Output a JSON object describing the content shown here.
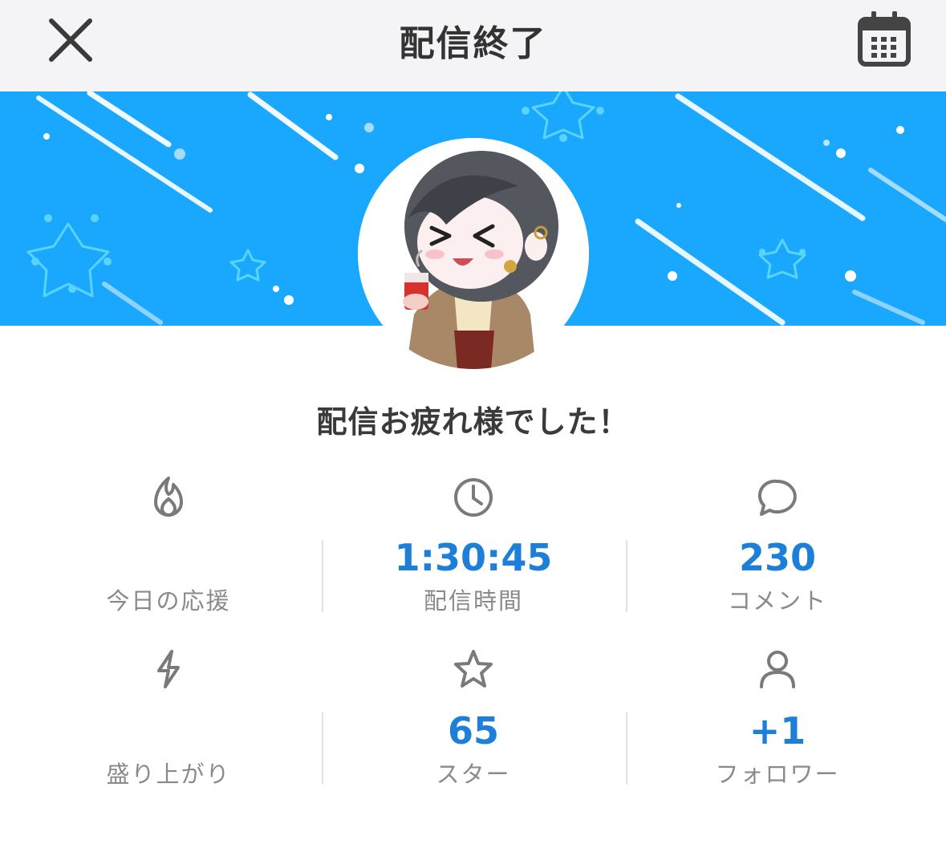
{
  "header": {
    "title": "配信終了",
    "close_icon": "close-icon",
    "calendar_icon": "calendar-icon"
  },
  "banner": {
    "background_color": "#1aa8ff"
  },
  "message": "配信お疲れ様でした！",
  "stats": [
    {
      "icon": "flame-icon",
      "value": "",
      "label": "今日の応援"
    },
    {
      "icon": "clock-icon",
      "value": "1:30:45",
      "label": "配信時間"
    },
    {
      "icon": "comment-icon",
      "value": "230",
      "label": "コメント"
    },
    {
      "icon": "lightning-icon",
      "value": "",
      "label": "盛り上がり"
    },
    {
      "icon": "star-icon",
      "value": "65",
      "label": "スター"
    },
    {
      "icon": "person-icon",
      "value": "+1",
      "label": "フォロワー"
    }
  ],
  "colors": {
    "accent": "#1e7fd8",
    "label": "#8a8a8a",
    "icon": "#7a7a7a"
  }
}
